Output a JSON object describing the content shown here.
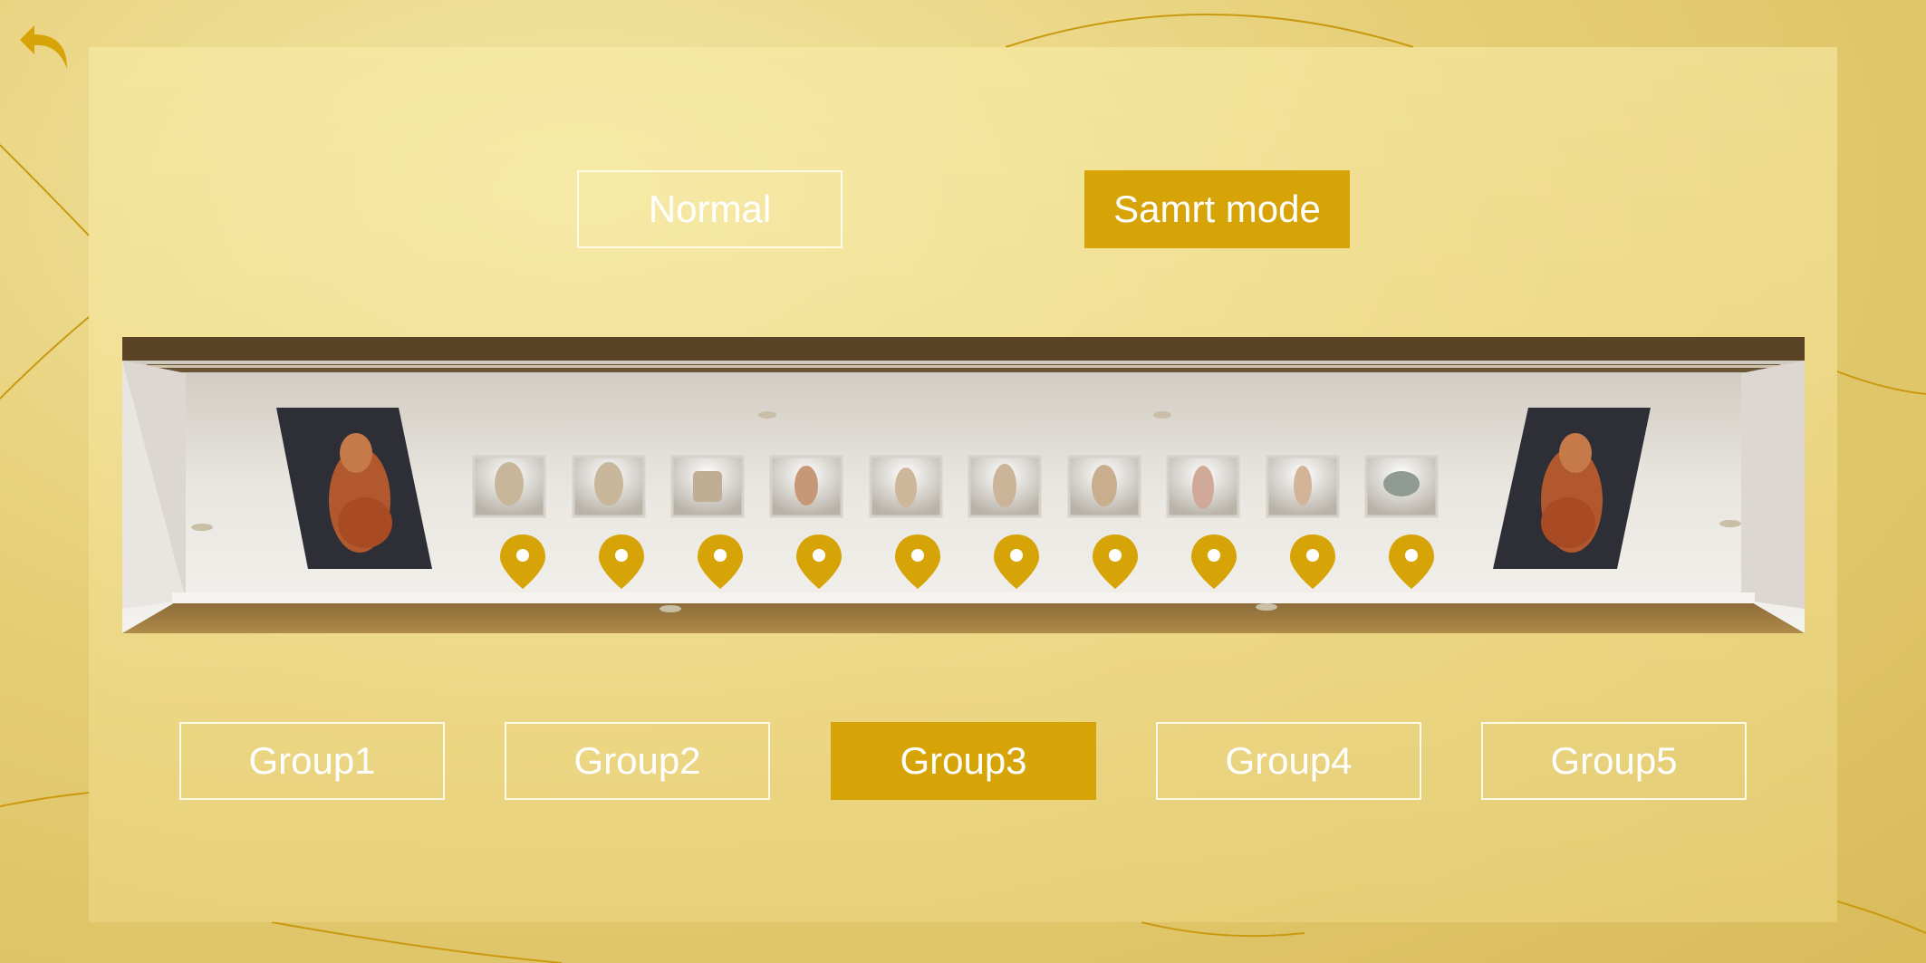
{
  "colors": {
    "accent": "#d6a407",
    "button_border": "#fffbe8",
    "button_text": "#ffffff"
  },
  "back_button": {
    "icon": "back-arrow-icon"
  },
  "mode_toggle": {
    "normal_label": "Normal",
    "smart_label": "Samrt mode",
    "selected": "Samrt mode"
  },
  "vitrine": {
    "exhibit_count": 10,
    "pin_icon": "map-pin-icon"
  },
  "groups": {
    "items": [
      {
        "label": "Group1"
      },
      {
        "label": "Group2"
      },
      {
        "label": "Group3"
      },
      {
        "label": "Group4"
      },
      {
        "label": "Group5"
      }
    ],
    "selected": "Group3"
  }
}
